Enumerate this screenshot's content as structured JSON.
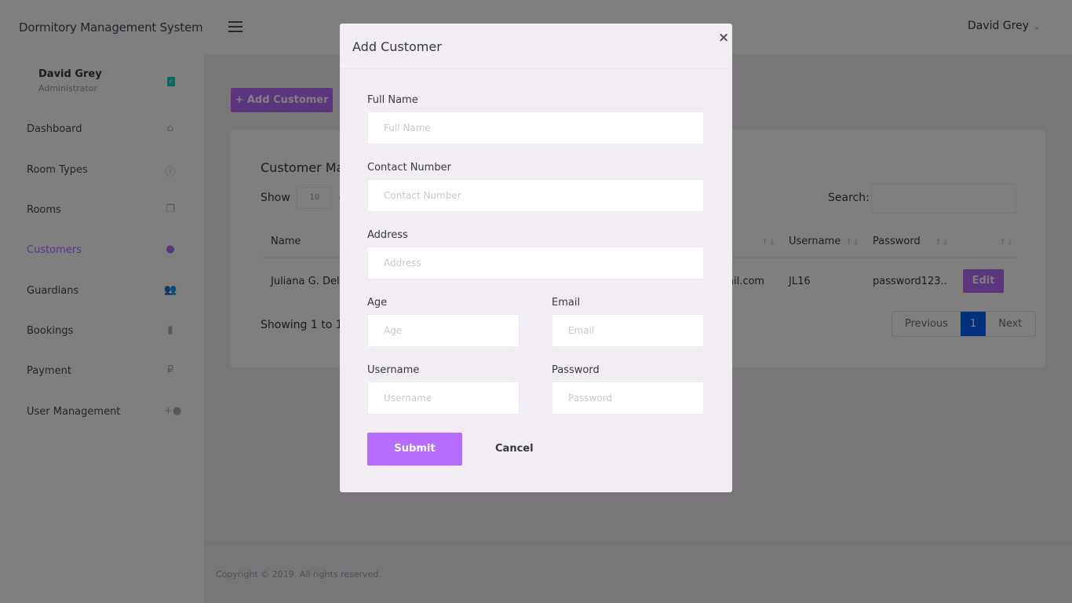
{
  "app": {
    "title": "Dormitory Management System"
  },
  "header": {
    "user_name": "David Grey",
    "chevron": "⌄"
  },
  "sidebar": {
    "profile": {
      "name": "David Grey",
      "role": "Administrator",
      "badge_icon": "✓"
    },
    "items": [
      {
        "label": "Dashboard",
        "icon": "⌂",
        "active": false
      },
      {
        "label": "Room Types",
        "icon": "ⓘ",
        "active": false
      },
      {
        "label": "Rooms",
        "icon": "❐",
        "active": false
      },
      {
        "label": "Customers",
        "icon": "●",
        "active": true
      },
      {
        "label": "Guardians",
        "icon": "👥",
        "active": false
      },
      {
        "label": "Bookings",
        "icon": "▮",
        "active": false
      },
      {
        "label": "Payment",
        "icon": "₽",
        "active": false
      },
      {
        "label": "User Management",
        "icon": "+●",
        "active": false
      }
    ]
  },
  "main": {
    "add_button": "+ Add Customer",
    "card_title": "Customer Ma",
    "show_label": "Show",
    "show_value": "10",
    "entries_label": "er",
    "search_label": "Search:",
    "columns": [
      "Name",
      "Username",
      "Password"
    ],
    "rows": [
      {
        "name": "Juliana G. Dela",
        "email_fragment": "ail.com",
        "username": "JL16",
        "password": "password123..",
        "action": "Edit"
      }
    ],
    "sort_icon": "↑↓",
    "info": "Showing 1 to 1",
    "pagination": {
      "previous": "Previous",
      "current": "1",
      "next": "Next"
    },
    "copyright": "Copyright © 2019. All rights reserved."
  },
  "modal": {
    "title": "Add Customer",
    "close": "×",
    "fields": {
      "full_name": {
        "label": "Full Name",
        "placeholder": "Full Name"
      },
      "contact": {
        "label": "Contact Number",
        "placeholder": "Contact Number"
      },
      "address": {
        "label": "Address",
        "placeholder": "Address"
      },
      "age": {
        "label": "Age",
        "placeholder": "Age"
      },
      "email": {
        "label": "Email",
        "placeholder": "Email"
      },
      "username": {
        "label": "Username",
        "placeholder": "Username"
      },
      "password": {
        "label": "Password",
        "placeholder": "Password"
      }
    },
    "submit": "Submit",
    "cancel": "Cancel"
  },
  "colors": {
    "accent": "#b66dff",
    "page_active": "#0062ff"
  }
}
